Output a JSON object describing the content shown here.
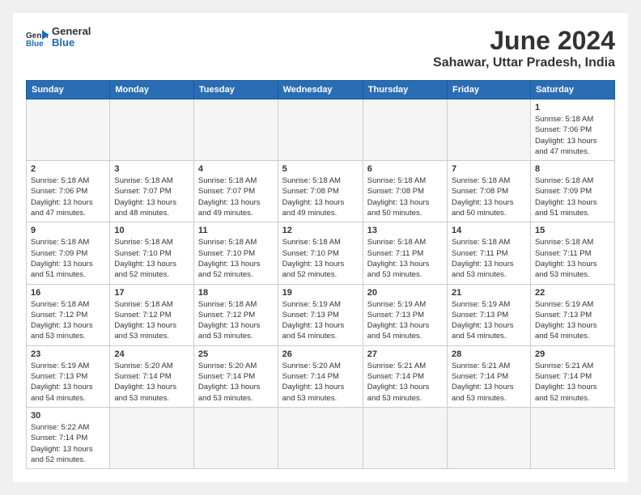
{
  "header": {
    "logo_line1": "General",
    "logo_line2": "Blue",
    "main_title": "June 2024",
    "subtitle": "Sahawar, Uttar Pradesh, India"
  },
  "days_of_week": [
    "Sunday",
    "Monday",
    "Tuesday",
    "Wednesday",
    "Thursday",
    "Friday",
    "Saturday"
  ],
  "weeks": [
    [
      {
        "day": "",
        "info": ""
      },
      {
        "day": "",
        "info": ""
      },
      {
        "day": "",
        "info": ""
      },
      {
        "day": "",
        "info": ""
      },
      {
        "day": "",
        "info": ""
      },
      {
        "day": "",
        "info": ""
      },
      {
        "day": "1",
        "info": "Sunrise: 5:18 AM\nSunset: 7:06 PM\nDaylight: 13 hours\nand 47 minutes."
      }
    ],
    [
      {
        "day": "2",
        "info": "Sunrise: 5:18 AM\nSunset: 7:06 PM\nDaylight: 13 hours\nand 47 minutes."
      },
      {
        "day": "3",
        "info": "Sunrise: 5:18 AM\nSunset: 7:07 PM\nDaylight: 13 hours\nand 48 minutes."
      },
      {
        "day": "4",
        "info": "Sunrise: 5:18 AM\nSunset: 7:07 PM\nDaylight: 13 hours\nand 49 minutes."
      },
      {
        "day": "5",
        "info": "Sunrise: 5:18 AM\nSunset: 7:08 PM\nDaylight: 13 hours\nand 49 minutes."
      },
      {
        "day": "6",
        "info": "Sunrise: 5:18 AM\nSunset: 7:08 PM\nDaylight: 13 hours\nand 50 minutes."
      },
      {
        "day": "7",
        "info": "Sunrise: 5:18 AM\nSunset: 7:08 PM\nDaylight: 13 hours\nand 50 minutes."
      },
      {
        "day": "8",
        "info": "Sunrise: 5:18 AM\nSunset: 7:09 PM\nDaylight: 13 hours\nand 51 minutes."
      }
    ],
    [
      {
        "day": "9",
        "info": "Sunrise: 5:18 AM\nSunset: 7:09 PM\nDaylight: 13 hours\nand 51 minutes."
      },
      {
        "day": "10",
        "info": "Sunrise: 5:18 AM\nSunset: 7:10 PM\nDaylight: 13 hours\nand 52 minutes."
      },
      {
        "day": "11",
        "info": "Sunrise: 5:18 AM\nSunset: 7:10 PM\nDaylight: 13 hours\nand 52 minutes."
      },
      {
        "day": "12",
        "info": "Sunrise: 5:18 AM\nSunset: 7:10 PM\nDaylight: 13 hours\nand 52 minutes."
      },
      {
        "day": "13",
        "info": "Sunrise: 5:18 AM\nSunset: 7:11 PM\nDaylight: 13 hours\nand 53 minutes."
      },
      {
        "day": "14",
        "info": "Sunrise: 5:18 AM\nSunset: 7:11 PM\nDaylight: 13 hours\nand 53 minutes."
      },
      {
        "day": "15",
        "info": "Sunrise: 5:18 AM\nSunset: 7:11 PM\nDaylight: 13 hours\nand 53 minutes."
      }
    ],
    [
      {
        "day": "16",
        "info": "Sunrise: 5:18 AM\nSunset: 7:12 PM\nDaylight: 13 hours\nand 53 minutes."
      },
      {
        "day": "17",
        "info": "Sunrise: 5:18 AM\nSunset: 7:12 PM\nDaylight: 13 hours\nand 53 minutes."
      },
      {
        "day": "18",
        "info": "Sunrise: 5:18 AM\nSunset: 7:12 PM\nDaylight: 13 hours\nand 53 minutes."
      },
      {
        "day": "19",
        "info": "Sunrise: 5:19 AM\nSunset: 7:13 PM\nDaylight: 13 hours\nand 54 minutes."
      },
      {
        "day": "20",
        "info": "Sunrise: 5:19 AM\nSunset: 7:13 PM\nDaylight: 13 hours\nand 54 minutes."
      },
      {
        "day": "21",
        "info": "Sunrise: 5:19 AM\nSunset: 7:13 PM\nDaylight: 13 hours\nand 54 minutes."
      },
      {
        "day": "22",
        "info": "Sunrise: 5:19 AM\nSunset: 7:13 PM\nDaylight: 13 hours\nand 54 minutes."
      }
    ],
    [
      {
        "day": "23",
        "info": "Sunrise: 5:19 AM\nSunset: 7:13 PM\nDaylight: 13 hours\nand 54 minutes."
      },
      {
        "day": "24",
        "info": "Sunrise: 5:20 AM\nSunset: 7:14 PM\nDaylight: 13 hours\nand 53 minutes."
      },
      {
        "day": "25",
        "info": "Sunrise: 5:20 AM\nSunset: 7:14 PM\nDaylight: 13 hours\nand 53 minutes."
      },
      {
        "day": "26",
        "info": "Sunrise: 5:20 AM\nSunset: 7:14 PM\nDaylight: 13 hours\nand 53 minutes."
      },
      {
        "day": "27",
        "info": "Sunrise: 5:21 AM\nSunset: 7:14 PM\nDaylight: 13 hours\nand 53 minutes."
      },
      {
        "day": "28",
        "info": "Sunrise: 5:21 AM\nSunset: 7:14 PM\nDaylight: 13 hours\nand 53 minutes."
      },
      {
        "day": "29",
        "info": "Sunrise: 5:21 AM\nSunset: 7:14 PM\nDaylight: 13 hours\nand 52 minutes."
      }
    ],
    [
      {
        "day": "30",
        "info": "Sunrise: 5:22 AM\nSunset: 7:14 PM\nDaylight: 13 hours\nand 52 minutes."
      },
      {
        "day": "",
        "info": ""
      },
      {
        "day": "",
        "info": ""
      },
      {
        "day": "",
        "info": ""
      },
      {
        "day": "",
        "info": ""
      },
      {
        "day": "",
        "info": ""
      },
      {
        "day": "",
        "info": ""
      }
    ]
  ]
}
